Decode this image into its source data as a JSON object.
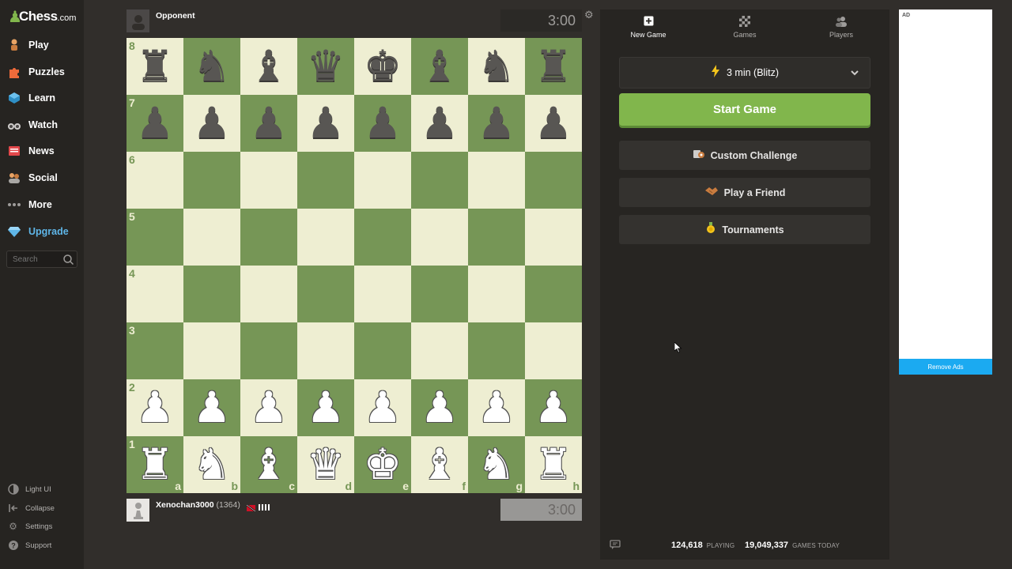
{
  "sidebar": {
    "logo": {
      "brand": "Chess",
      "suffix": ".com"
    },
    "nav": [
      {
        "label": "Play",
        "icon": "play-icon",
        "color": "#e8a365"
      },
      {
        "label": "Puzzles",
        "icon": "puzzle-icon",
        "color": "#ef6a3a"
      },
      {
        "label": "Learn",
        "icon": "learn-icon",
        "color": "#4aa7d8"
      },
      {
        "label": "Watch",
        "icon": "binoculars-icon",
        "color": "#cfcdcb"
      },
      {
        "label": "News",
        "icon": "news-icon",
        "color": "#e2484b"
      },
      {
        "label": "Social",
        "icon": "social-icon",
        "color": "#e8a365"
      },
      {
        "label": "More",
        "icon": "more-icon",
        "color": "#9e9c9a"
      },
      {
        "label": "Upgrade",
        "icon": "diamond-icon",
        "color": "#5fb6e8"
      }
    ],
    "search_placeholder": "Search",
    "bottom": [
      {
        "label": "Light UI",
        "icon": "contrast-icon"
      },
      {
        "label": "Collapse",
        "icon": "collapse-icon"
      },
      {
        "label": "Settings",
        "icon": "gear-icon"
      },
      {
        "label": "Support",
        "icon": "help-icon"
      }
    ]
  },
  "board": {
    "top_player": {
      "name": "Opponent",
      "clock": "3:00"
    },
    "bottom_player": {
      "name": "Xenochan3000",
      "rating": "(1364)",
      "clock": "3:00"
    },
    "ranks": [
      "8",
      "7",
      "6",
      "5",
      "4",
      "3",
      "2",
      "1"
    ],
    "files": [
      "a",
      "b",
      "c",
      "d",
      "e",
      "f",
      "g",
      "h"
    ],
    "position": [
      [
        "bR",
        "bN",
        "bB",
        "bQ",
        "bK",
        "bB",
        "bN",
        "bR"
      ],
      [
        "bP",
        "bP",
        "bP",
        "bP",
        "bP",
        "bP",
        "bP",
        "bP"
      ],
      [
        "",
        "",
        "",
        "",
        "",
        "",
        "",
        ""
      ],
      [
        "",
        "",
        "",
        "",
        "",
        "",
        "",
        ""
      ],
      [
        "",
        "",
        "",
        "",
        "",
        "",
        "",
        ""
      ],
      [
        "",
        "",
        "",
        "",
        "",
        "",
        "",
        ""
      ],
      [
        "wP",
        "wP",
        "wP",
        "wP",
        "wP",
        "wP",
        "wP",
        "wP"
      ],
      [
        "wR",
        "wN",
        "wB",
        "wQ",
        "wK",
        "wB",
        "wN",
        "wR"
      ]
    ]
  },
  "panel": {
    "tabs": [
      {
        "label": "New Game",
        "icon": "plus-square-icon",
        "active": true
      },
      {
        "label": "Games",
        "icon": "board-icon",
        "active": false
      },
      {
        "label": "Players",
        "icon": "players-icon",
        "active": false
      }
    ],
    "time_control": "3 min (Blitz)",
    "start_label": "Start Game",
    "options": [
      {
        "label": "Custom Challenge",
        "icon": "custom-challenge-icon"
      },
      {
        "label": "Play a Friend",
        "icon": "handshake-icon"
      },
      {
        "label": "Tournaments",
        "icon": "trophy-icon"
      }
    ],
    "stats": {
      "playing_count": "124,618",
      "playing_label": "PLAYING",
      "games_count": "19,049,337",
      "games_label": "GAMES TODAY"
    }
  },
  "ad": {
    "label": "AD",
    "remove_label": "Remove Ads"
  },
  "colors": {
    "board_light": "#eeeed2",
    "board_dark": "#769656",
    "start_green": "#81b64c",
    "remove_ads_blue": "#1baaf1"
  }
}
